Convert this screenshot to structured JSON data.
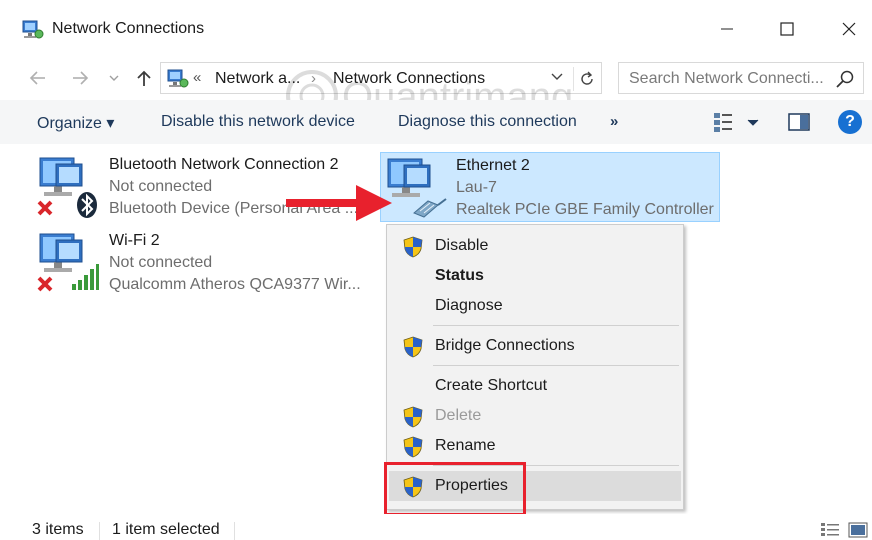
{
  "window": {
    "title": "Network Connections"
  },
  "address": {
    "prefix": "«",
    "segment1": "Network a...",
    "separator": "›",
    "segment2": "Network Connections"
  },
  "search": {
    "placeholder": "Search Network Connecti..."
  },
  "watermark": {
    "text": "Quantrimang"
  },
  "commandbar": {
    "organize": "Organize ▾",
    "disable": "Disable this network device",
    "diagnose": "Diagnose this connection",
    "more": "»",
    "help": "?"
  },
  "items": [
    {
      "name": "Bluetooth Network Connection 2",
      "status": "Not connected",
      "device": "Bluetooth Device (Personal Area ..."
    },
    {
      "name": "Wi-Fi 2",
      "status": "Not connected",
      "device": "Qualcomm Atheros QCA9377 Wir..."
    },
    {
      "name": "Ethernet 2",
      "status": "Lau-7",
      "device": "Realtek PCIe GBE Family Controller"
    }
  ],
  "context_menu": {
    "disable": "Disable",
    "status": "Status",
    "diagnose": "Diagnose",
    "bridge": "Bridge Connections",
    "shortcut": "Create Shortcut",
    "delete": "Delete",
    "rename": "Rename",
    "properties": "Properties"
  },
  "statusbar": {
    "count": "3 items",
    "selected": "1 item selected"
  },
  "colors": {
    "selection_bg": "#cce8ff",
    "selection_border": "#99d1ff",
    "highlight_red": "#e8212d",
    "command_text": "#1e395b",
    "help_blue": "#1770d2"
  },
  "icons": {
    "app": "network-connections-icon",
    "back": "arrow-left-icon",
    "forward": "arrow-right-icon",
    "up": "arrow-up-icon",
    "refresh": "refresh-icon",
    "search": "search-icon",
    "shield": "uac-shield-icon"
  }
}
